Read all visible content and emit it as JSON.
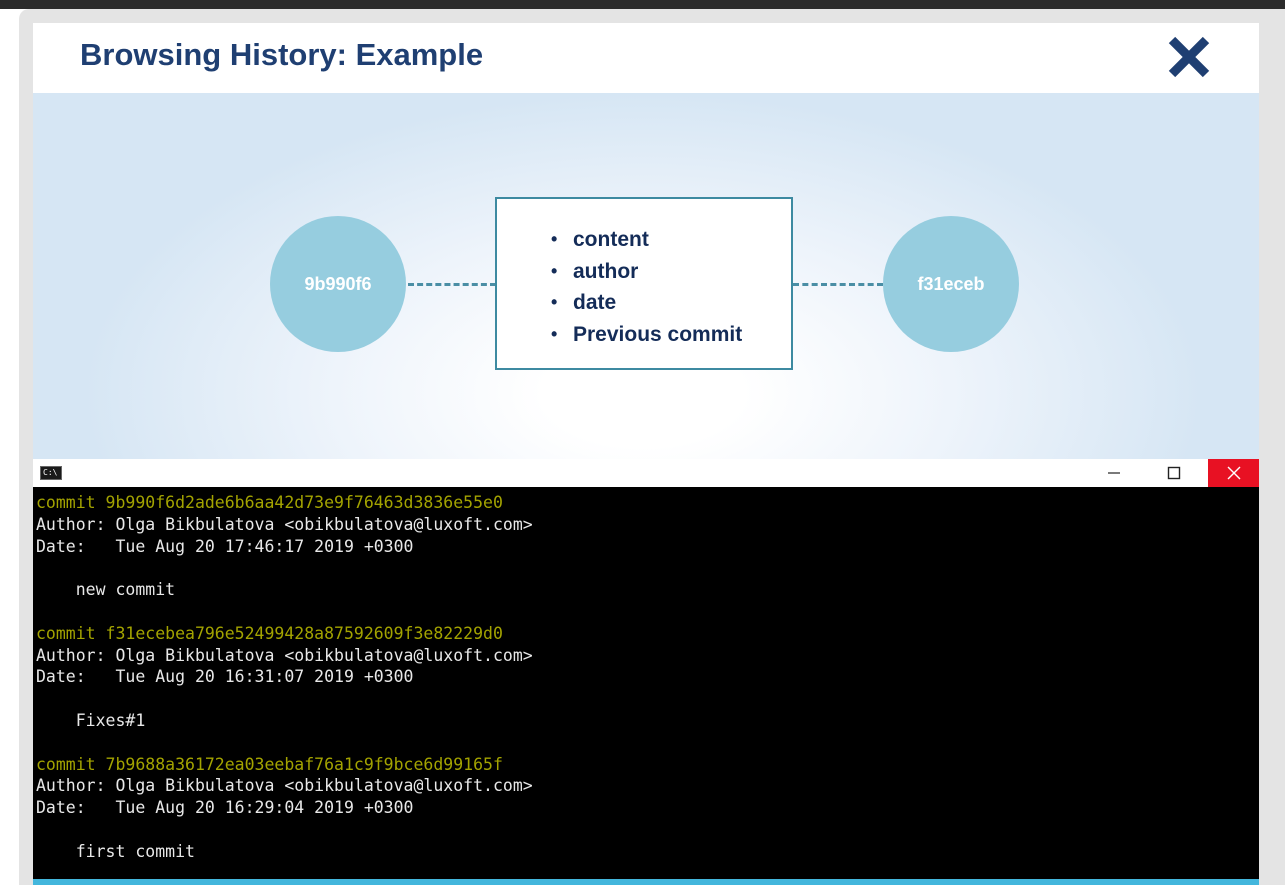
{
  "header": {
    "title": "Browsing History: Example"
  },
  "diagram": {
    "node_left": "9b990f6",
    "node_right": "f31eceb",
    "properties": [
      "content",
      "author",
      "date",
      "Previous commit"
    ]
  },
  "console": {
    "lines": [
      {
        "text": "commit 9b990f6d2ade6b6aa42d73e9f76463d3836e55e0",
        "kind": "commit"
      },
      {
        "text": "Author: Olga Bikbulatova <obikbulatova@luxoft.com>",
        "kind": "text"
      },
      {
        "text": "Date:   Tue Aug 20 17:46:17 2019 +0300",
        "kind": "text"
      },
      {
        "text": "",
        "kind": "text"
      },
      {
        "text": "    new commit",
        "kind": "text"
      },
      {
        "text": "",
        "kind": "text"
      },
      {
        "text": "commit f31ecebea796e52499428a87592609f3e82229d0",
        "kind": "commit"
      },
      {
        "text": "Author: Olga Bikbulatova <obikbulatova@luxoft.com>",
        "kind": "text"
      },
      {
        "text": "Date:   Tue Aug 20 16:31:07 2019 +0300",
        "kind": "text"
      },
      {
        "text": "",
        "kind": "text"
      },
      {
        "text": "    Fixes#1",
        "kind": "text"
      },
      {
        "text": "",
        "kind": "text"
      },
      {
        "text": "commit 7b9688a36172ea03eebaf76a1c9f9bce6d99165f",
        "kind": "commit"
      },
      {
        "text": "Author: Olga Bikbulatova <obikbulatova@luxoft.com>",
        "kind": "text"
      },
      {
        "text": "Date:   Tue Aug 20 16:29:04 2019 +0300",
        "kind": "text"
      },
      {
        "text": "",
        "kind": "text"
      },
      {
        "text": "    first commit",
        "kind": "text"
      }
    ],
    "commit_color": "#a3a300",
    "text_color": "#e8e8e8"
  },
  "icons": {
    "close": "close-icon",
    "console": "console-app-icon",
    "minimize": "minimize-icon",
    "maximize": "maximize-icon",
    "window_close": "window-close-icon"
  },
  "colors": {
    "title": "#1f3f72",
    "node": "#96cddf",
    "box_border": "#3d8aa1",
    "close_red": "#e81123",
    "accent_bar": "#43b6dc"
  }
}
